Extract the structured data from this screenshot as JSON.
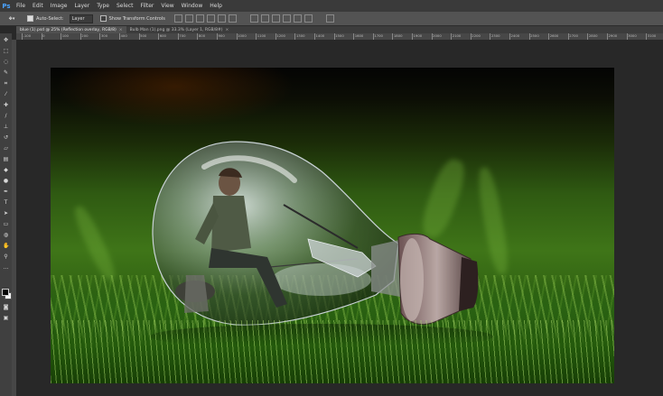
{
  "app": {
    "logo": "Ps"
  },
  "menu": [
    "File",
    "Edit",
    "Image",
    "Layer",
    "Type",
    "Select",
    "Filter",
    "View",
    "Window",
    "Help"
  ],
  "options": {
    "tool_icon": "move-tool-icon",
    "auto_select_label": "Auto-Select:",
    "auto_select_value": "Layer",
    "transform_label": "Show Transform Controls"
  },
  "tabs": [
    {
      "label": "blue (1).psd @ 25% (Reflection overlay, RGB/8)",
      "active": true
    },
    {
      "label": "Bulb Man (1).png @ 33.3% (Layer 1, RGB/8#)",
      "active": false
    }
  ],
  "ruler": [
    "-100",
    "0",
    "100",
    "200",
    "300",
    "400",
    "500",
    "600",
    "700",
    "800",
    "900",
    "1000",
    "1100",
    "1200",
    "1300",
    "1400",
    "1500",
    "1600",
    "1700",
    "1800",
    "1900",
    "2000",
    "2100",
    "2200",
    "2300",
    "2400",
    "2500",
    "2600",
    "2700",
    "2800",
    "2900",
    "3000",
    "3100",
    "3200"
  ],
  "colors": {
    "foreground": "#050505",
    "background": "#f4f4f4",
    "accent": "#4aa3ff"
  }
}
